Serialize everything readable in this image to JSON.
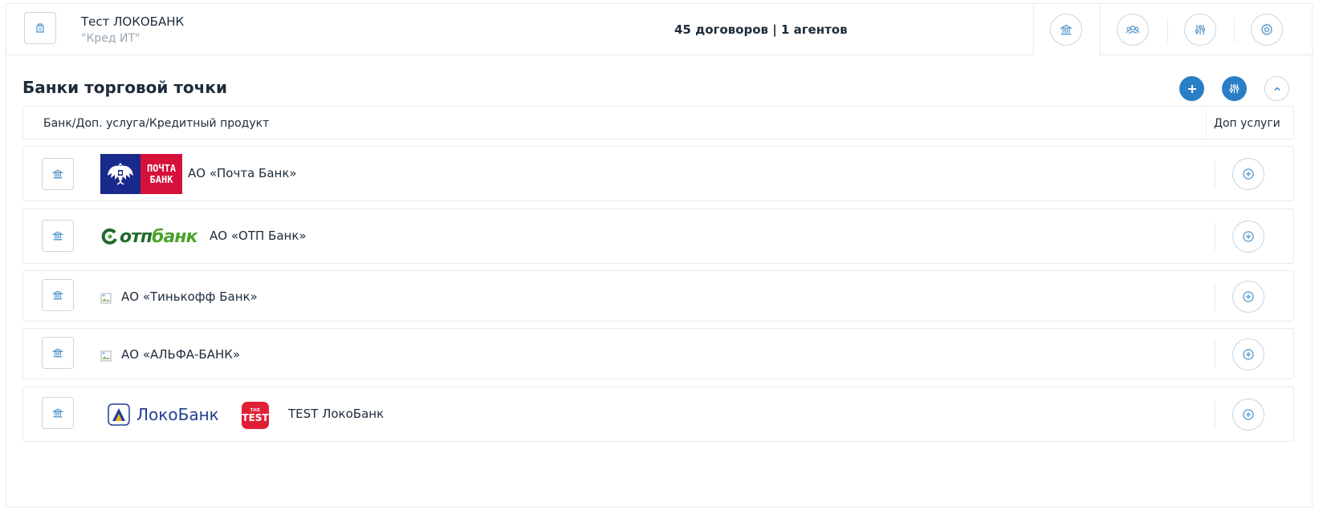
{
  "header": {
    "store_name": "Тест ЛОКОБАНК",
    "company_name": "\"Кред ИТ\"",
    "stats": "45 договоров | 1 агентов",
    "icons": [
      "bank-icon",
      "users-icon",
      "sliders-icon",
      "gear-icon"
    ]
  },
  "section": {
    "title": "Банки торговой точки",
    "actions": [
      "plus-icon",
      "sliders-icon",
      "chevron-up-icon"
    ]
  },
  "table": {
    "col_bank": "Банк/Доп. услуга/Кредитный продукт",
    "col_services": "Доп услуги"
  },
  "banks": [
    {
      "name": "АО «Почта Банк»",
      "logo": "pochta-bank-logo",
      "logo_text": [
        "ПОЧТА",
        "БАНК"
      ]
    },
    {
      "name": "АО «ОТП Банк»",
      "logo": "otp-bank-logo",
      "logo_text": [
        "отп",
        "банк"
      ]
    },
    {
      "name": "АО «Тинькофф Банк»",
      "logo": "broken-image-icon"
    },
    {
      "name": "АО «АЛЬФА-БАНК»",
      "logo": "broken-image-icon"
    },
    {
      "name": "TEST ЛокоБанк",
      "logo": "loko-bank-logo",
      "logo_text": "ЛокоБанк",
      "badge_small": "THE",
      "badge_big": "TEST"
    }
  ],
  "colors": {
    "accent": "#2a7ec5",
    "border": "#e3ecf3",
    "icon": "#4a90c8"
  }
}
